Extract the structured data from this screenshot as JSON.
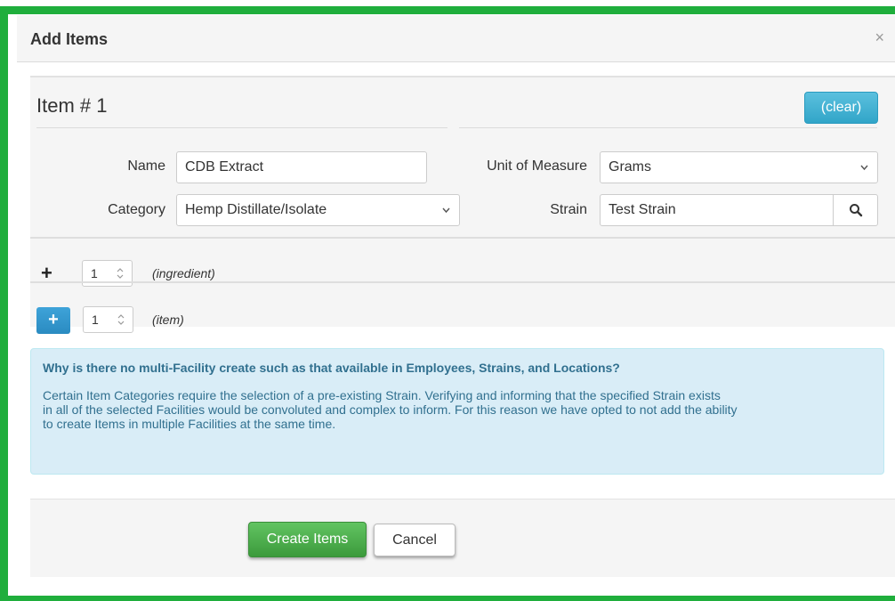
{
  "modal": {
    "title": "Add Items",
    "close_icon": "×"
  },
  "item": {
    "title": "Item # 1",
    "clear_label": "(clear)",
    "name_label": "Name",
    "name_value": "CDB Extract",
    "category_label": "Category",
    "category_value": "Hemp Distillate/Isolate",
    "uom_label": "Unit of Measure",
    "uom_value": "Grams",
    "strain_label": "Strain",
    "strain_value": "Test Strain"
  },
  "ingredient": {
    "count": "1",
    "hint": "(ingredient)"
  },
  "item_count": {
    "count": "1",
    "hint": "(item)"
  },
  "alert": {
    "heading": "Why is there no multi-Facility create such as that available in Employees, Strains, and Locations?",
    "line1": "Certain Item Categories require the selection of a pre-existing Strain. Verifying and informing that the specified Strain exists",
    "line2": "in all of the selected Facilities would be convoluted and complex to inform. For this reason we have opted to not add the ability",
    "line3": "to create Items in multiple Facilities at the same time."
  },
  "footer": {
    "create_label": "Create Items",
    "cancel_label": "Cancel"
  },
  "colors": {
    "frame": "#1fae3c",
    "info_button": "#5bc0de",
    "create_button": "#5cb85c",
    "alert_bg": "#d9edf7",
    "alert_text": "#31708f"
  },
  "icons": {
    "close": "close-icon",
    "search": "search-icon",
    "add": "plus-icon",
    "dropdown": "chevron-down-icon",
    "stepper": "stepper-arrows-icon"
  }
}
